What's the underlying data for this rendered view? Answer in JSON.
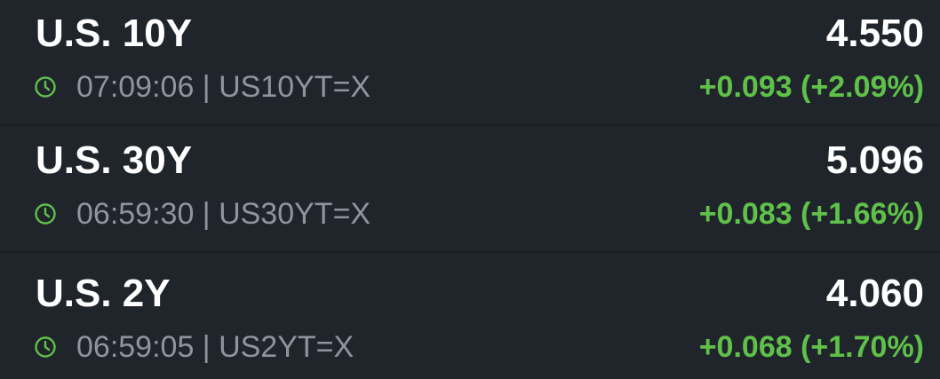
{
  "colors": {
    "background": "#20252b",
    "divider": "#1a1e23",
    "primary_text": "#ffffff",
    "secondary_text": "#8f959c",
    "positive": "#5fc14a"
  },
  "quotes": [
    {
      "name": "U.S. 10Y",
      "price": "4.550",
      "time_symbol": "07:09:06 | US10YT=X",
      "change": "+0.093 (+2.09%)",
      "icon": "clock-icon"
    },
    {
      "name": "U.S. 30Y",
      "price": "5.096",
      "time_symbol": "06:59:30 | US30YT=X",
      "change": "+0.083 (+1.66%)",
      "icon": "clock-icon"
    },
    {
      "name": "U.S. 2Y",
      "price": "4.060",
      "time_symbol": "06:59:05 | US2YT=X",
      "change": "+0.068 (+1.70%)",
      "icon": "clock-icon"
    }
  ]
}
